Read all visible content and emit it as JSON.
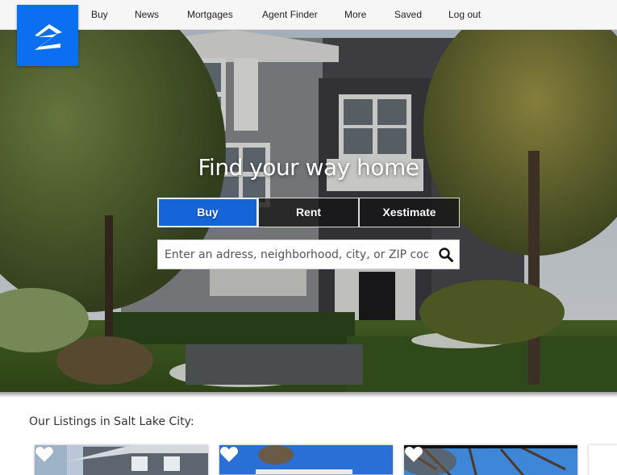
{
  "nav": {
    "items": [
      {
        "label": "Buy"
      },
      {
        "label": "News"
      },
      {
        "label": "Mortgages"
      },
      {
        "label": "Agent Finder"
      },
      {
        "label": "More"
      },
      {
        "label": "Saved"
      },
      {
        "label": "Log out"
      }
    ],
    "logo_icon": "zillow-z-icon",
    "brand_color": "#0b6ff2"
  },
  "hero": {
    "title": "Find your way home",
    "tabs": [
      {
        "label": "Buy",
        "active": true
      },
      {
        "label": "Rent",
        "active": false
      },
      {
        "label": "Xestimate",
        "active": false
      }
    ],
    "search": {
      "placeholder": "Enter an adress, neighborhood, city, or ZIP code",
      "value": "",
      "button_icon": "search-icon"
    }
  },
  "listings": {
    "heading": "Our Listings in Salt Lake City:",
    "cards": [
      {
        "favorite_icon": "heart-icon"
      },
      {
        "favorite_icon": "heart-icon"
      },
      {
        "favorite_icon": "heart-icon"
      },
      {
        "favorite_icon": "none"
      }
    ]
  },
  "colors": {
    "active_tab": "#1565d8",
    "inactive_tab": "#1a1a1a"
  }
}
